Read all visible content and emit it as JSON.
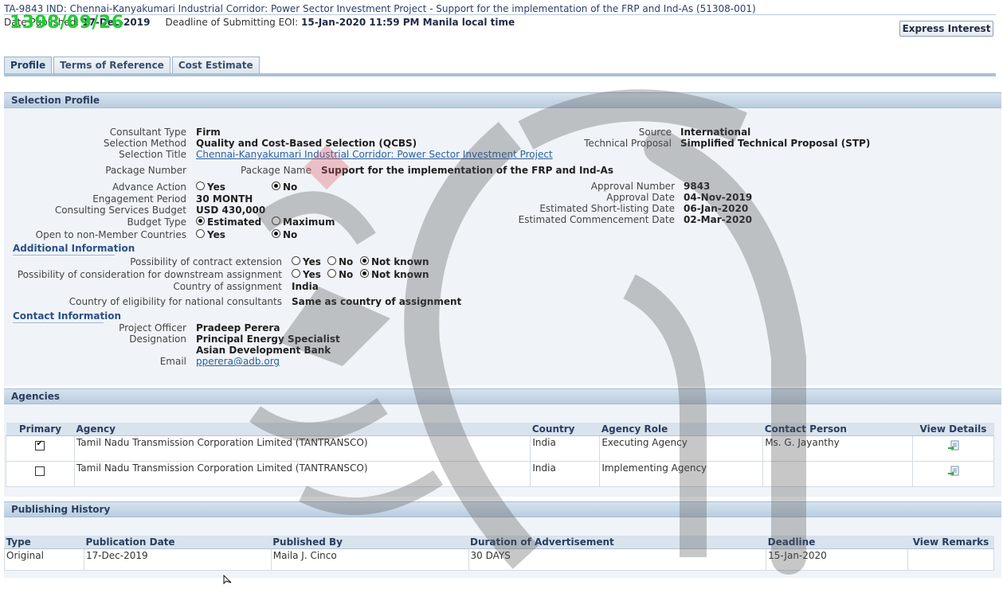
{
  "header": {
    "title": "TA-9843 IND: Chennai-Kanyakumari Industrial Corridor: Power Sector Investment Project - Support for the implementation of the FRP and Ind-As (51308-001)",
    "date_published_label": "Date Published:",
    "date_published": "17-Dec-2019",
    "deadline_label": "Deadline of Submitting EOI:",
    "deadline_value": "15-Jan-2020 11:59 PM Manila local time",
    "stamp": "1398/09/26",
    "express_interest": "Express Interest"
  },
  "tabs": [
    {
      "label": "Profile",
      "active": true
    },
    {
      "label": "Terms of Reference",
      "active": false
    },
    {
      "label": "Cost Estimate",
      "active": false
    }
  ],
  "selection_profile": {
    "heading": "Selection Profile",
    "consultant_type_label": "Consultant Type",
    "consultant_type": "Firm",
    "selection_method_label": "Selection Method",
    "selection_method": "Quality and Cost-Based Selection (QCBS)",
    "selection_title_label": "Selection Title",
    "selection_title": "Chennai-Kanyakumari Industrial Corridor: Power Sector Investment Project",
    "package_number_label": "Package Number",
    "package_name_label": "Package Name",
    "package_name": "Support for the implementation of the FRP and Ind-As",
    "advance_action_label": "Advance Action",
    "engagement_period_label": "Engagement Period",
    "engagement_period": "30 MONTH",
    "consulting_budget_label": "Consulting Services Budget",
    "consulting_budget": "USD 430,000",
    "budget_type_label": "Budget Type",
    "open_label": "Open to non-Member Countries",
    "source_label": "Source",
    "source": "International",
    "technical_proposal_label": "Technical Proposal",
    "technical_proposal": "Simplified Technical Proposal (STP)",
    "approval_number_label": "Approval Number",
    "approval_number": "9843",
    "approval_date_label": "Approval Date",
    "approval_date": "04-Nov-2019",
    "shortlisting_label": "Estimated Short-listing Date",
    "shortlisting_date": "06-Jan-2020",
    "commencement_label": "Estimated Commencement Date",
    "commencement_date": "02-Mar-2020",
    "opt_yes": "Yes",
    "opt_no": "No",
    "opt_estimated": "Estimated",
    "opt_maximum": "Maximum",
    "opt_not_known": "Not known"
  },
  "additional": {
    "heading": "Additional Information",
    "extension_label": "Possibility of contract extension",
    "downstream_label": "Possibility of consideration for downstream assignment",
    "country_assignment_label": "Country of assignment",
    "country_assignment": "India",
    "eligibility_label": "Country of eligibility for national consultants",
    "eligibility": "Same as country of assignment"
  },
  "contact": {
    "heading": "Contact Information",
    "officer_label": "Project Officer",
    "officer": "Pradeep Perera",
    "designation_label": "Designation",
    "designation": "Principal Energy Specialist",
    "org": "Asian Development Bank",
    "email_label": "Email",
    "email": "pperera@adb.org"
  },
  "agencies": {
    "heading": "Agencies",
    "columns": [
      "Primary",
      "Agency",
      "Country",
      "Agency Role",
      "Contact Person",
      "View Details"
    ],
    "rows": [
      {
        "primary": true,
        "agency": "Tamil Nadu Transmission Corporation Limited (TANTRANSCO)",
        "country": "India",
        "role": "Executing Agency",
        "contact": "Ms. G. Jayanthy"
      },
      {
        "primary": false,
        "agency": "Tamil Nadu Transmission Corporation Limited (TANTRANSCO)",
        "country": "India",
        "role": "Implementing Agency",
        "contact": ""
      }
    ]
  },
  "publishing": {
    "heading": "Publishing History",
    "columns": [
      "Type",
      "Publication Date",
      "Published By",
      "Duration of Advertisement",
      "Deadline",
      "View Remarks"
    ],
    "rows": [
      {
        "type": "Original",
        "date": "17-Dec-2019",
        "by": "Maila J. Cinco",
        "duration": "30 DAYS",
        "deadline": "15-Jan-2020",
        "remarks": ""
      }
    ]
  },
  "colors": {
    "accent": "#2b5f9e",
    "header_bg": "#c9d9e8",
    "stamp": "#22cc33"
  }
}
